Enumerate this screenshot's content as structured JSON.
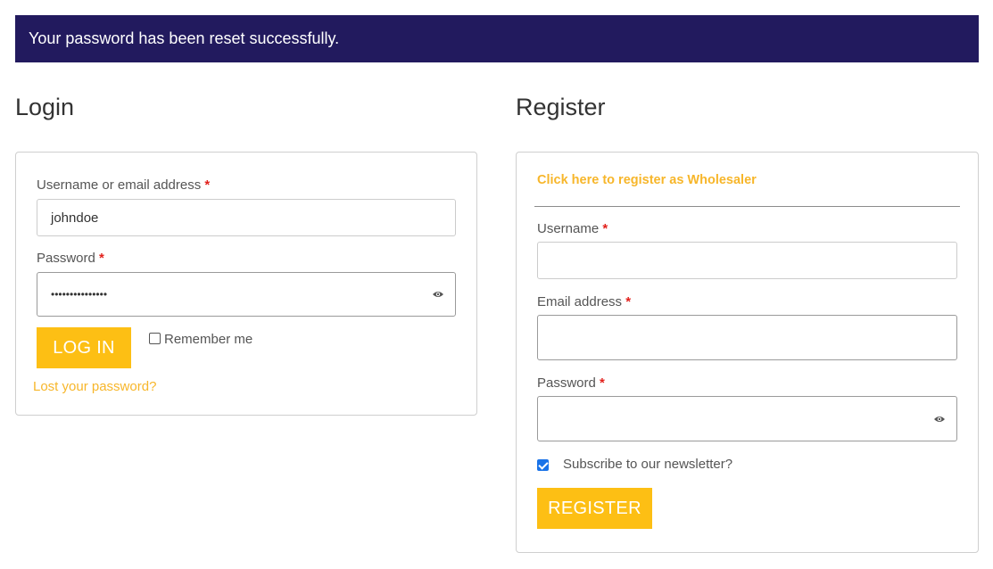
{
  "notice": {
    "message": "Your password has been reset successfully."
  },
  "login": {
    "title": "Login",
    "username_label": "Username or email address",
    "username_value": "johndoe",
    "password_label": "Password",
    "password_value": "•••••••••••••••",
    "login_button": "LOG IN",
    "remember_label": "Remember me",
    "remember_checked": false,
    "lost_password_link": "Lost your password?"
  },
  "register": {
    "title": "Register",
    "wholesaler_link": "Click here to register as Wholesaler",
    "username_label": "Username",
    "email_label": "Email address",
    "password_label": "Password",
    "newsletter_label": "Subscribe to our newsletter?",
    "newsletter_checked": true,
    "register_button": "REGISTER"
  },
  "required_marker": "*",
  "colors": {
    "notice_bg": "#221a5e",
    "accent": "#fdbf14",
    "link": "#f7b62a",
    "required": "#e2211c"
  },
  "icons": {
    "password_toggle": "eye-icon"
  }
}
